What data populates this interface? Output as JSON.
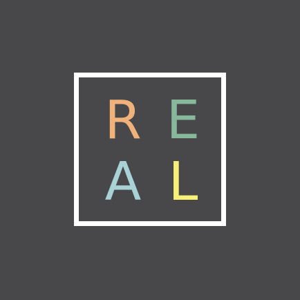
{
  "logo": {
    "letters": [
      {
        "char": "R",
        "color": "#f0b27a"
      },
      {
        "char": "E",
        "color": "#88b89c"
      },
      {
        "char": "A",
        "color": "#a9d2d6"
      },
      {
        "char": "L",
        "color": "#f6ef78"
      }
    ],
    "frame_color": "#ffffff",
    "background_color": "#48484b"
  }
}
